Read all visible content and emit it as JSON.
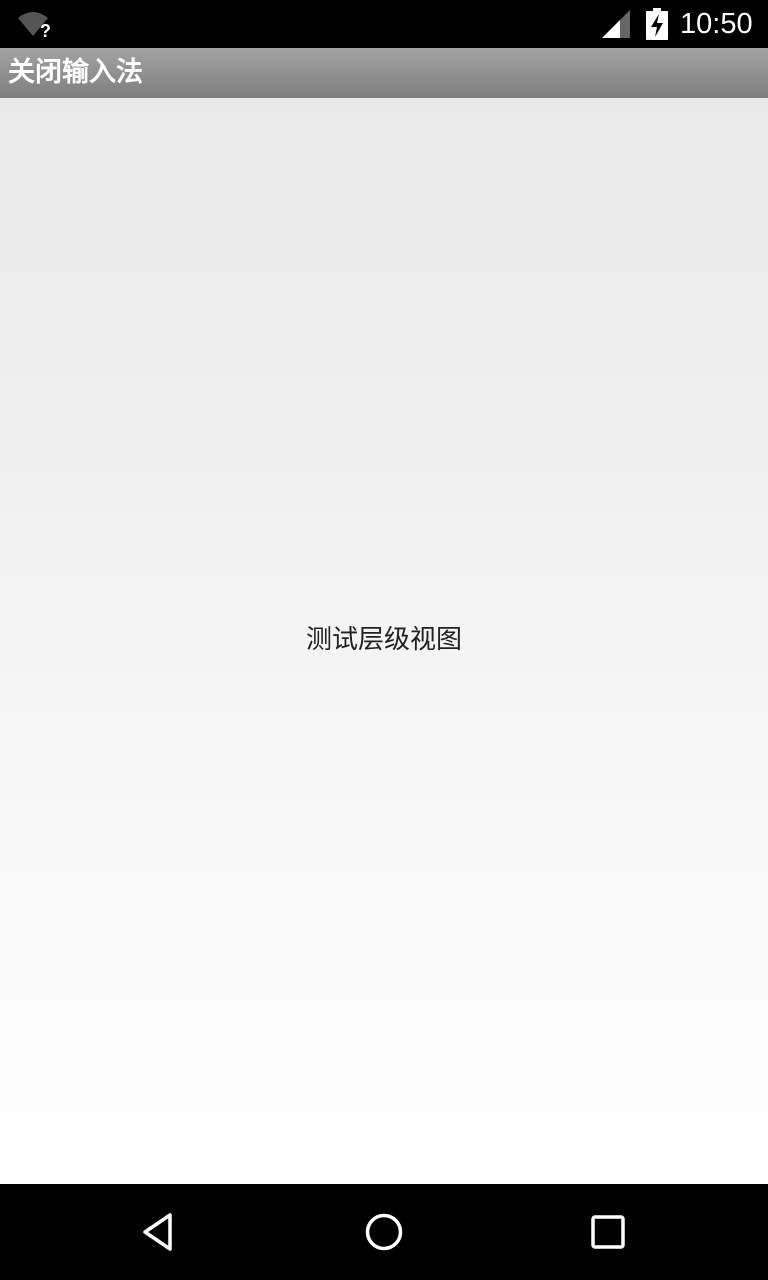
{
  "status_bar": {
    "time": "10:50",
    "wifi_icon": "wifi-unknown-icon",
    "wifi_badge": "?",
    "signal_icon": "cell-signal-icon",
    "battery_icon": "battery-charging-icon"
  },
  "action_bar": {
    "title": "关闭输入法"
  },
  "content": {
    "text": "测试层级视图"
  },
  "nav_bar": {
    "back_icon": "back-icon",
    "home_icon": "home-icon",
    "recents_icon": "recents-icon"
  }
}
